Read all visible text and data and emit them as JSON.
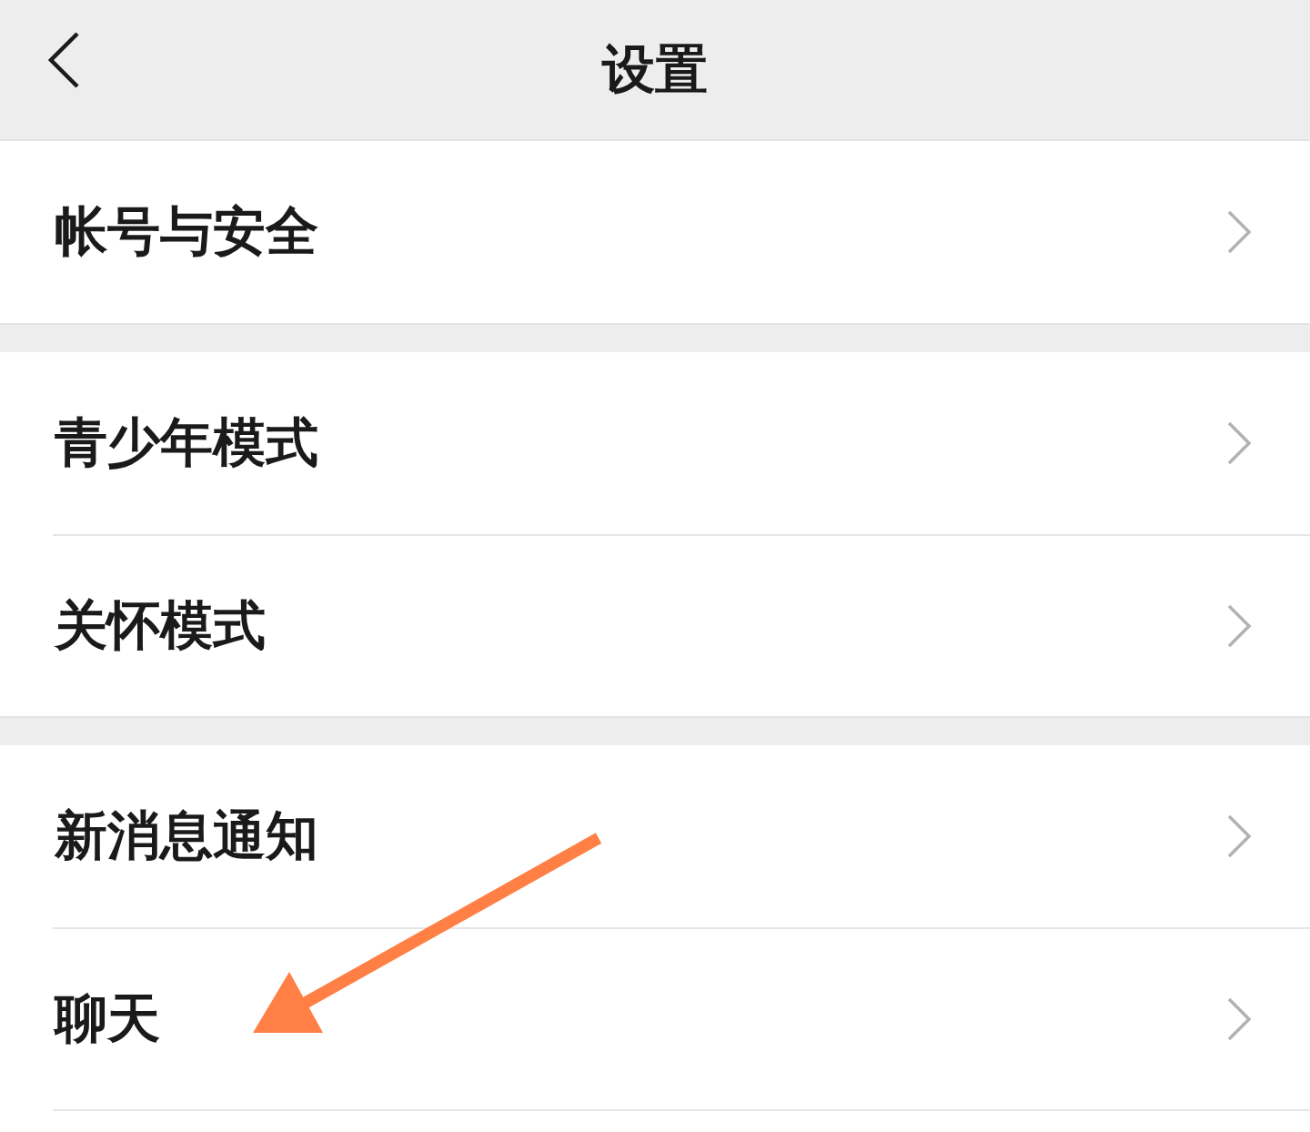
{
  "header": {
    "title": "设置"
  },
  "groups": [
    {
      "items": [
        {
          "label": "帐号与安全"
        }
      ]
    },
    {
      "items": [
        {
          "label": "青少年模式"
        },
        {
          "label": "关怀模式"
        }
      ]
    },
    {
      "items": [
        {
          "label": "新消息通知"
        },
        {
          "label": "聊天"
        }
      ]
    }
  ],
  "annotation": {
    "kind": "arrow",
    "color": "#ff7f45"
  }
}
